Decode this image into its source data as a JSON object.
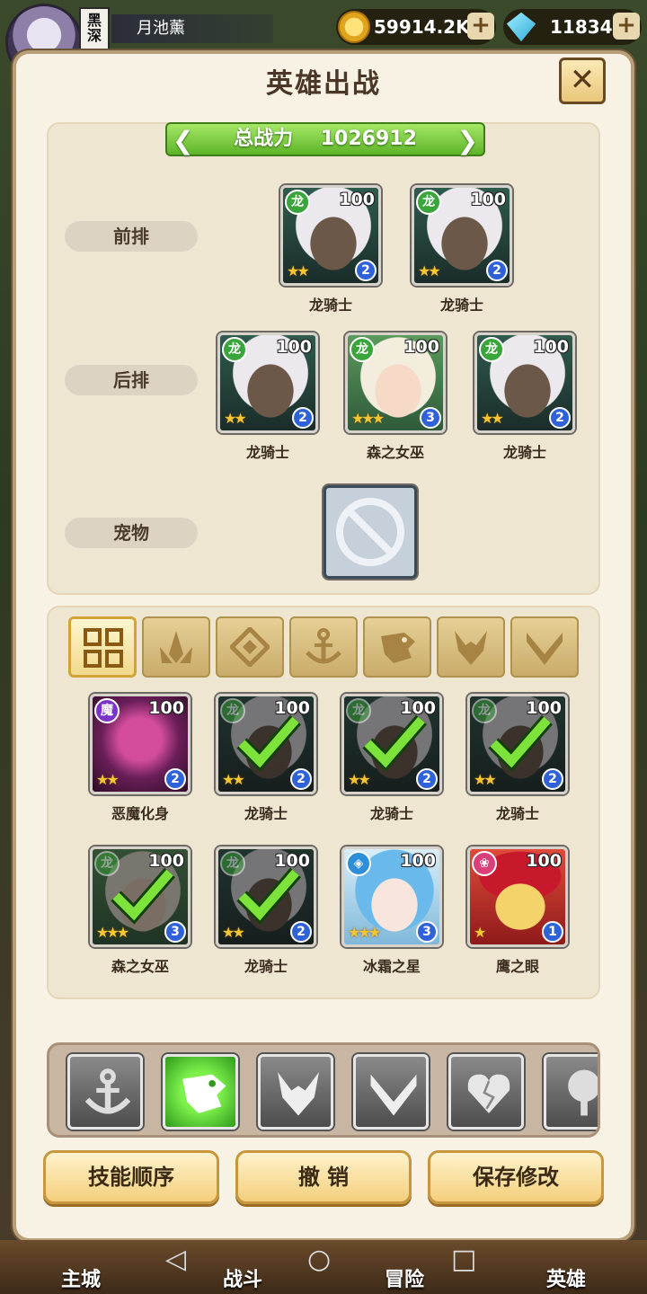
{
  "player": {
    "guild_tag": "黑\n深",
    "name": "月池薰"
  },
  "currency": {
    "gold": "59914.2K",
    "gems": "11834",
    "plus": "+"
  },
  "panel": {
    "title": "英雄出战",
    "close_icon": "close-icon"
  },
  "formation": {
    "power_label": "总战力",
    "power_value": "1026912",
    "rows": {
      "front": "前排",
      "back": "后排",
      "pet": "宠物"
    },
    "front": [
      {
        "name": "龙骑士",
        "level": "100",
        "rank": "2",
        "class": "dragon",
        "stars": "★★"
      },
      {
        "name": "龙骑士",
        "level": "100",
        "rank": "2",
        "class": "dragon",
        "stars": "★★"
      }
    ],
    "back": [
      {
        "name": "龙骑士",
        "level": "100",
        "rank": "2",
        "class": "dragon",
        "stars": "★★"
      },
      {
        "name": "森之女巫",
        "level": "100",
        "rank": "3",
        "class": "dragon",
        "stars": "★★★"
      },
      {
        "name": "龙骑士",
        "level": "100",
        "rank": "2",
        "class": "dragon",
        "stars": "★★"
      }
    ]
  },
  "roster": {
    "filters": [
      "all",
      "forest",
      "frost",
      "anchor",
      "dragon",
      "demon",
      "light"
    ],
    "heroes": [
      {
        "name": "恶魔化身",
        "level": "100",
        "rank": "2",
        "selected": false
      },
      {
        "name": "龙骑士",
        "level": "100",
        "rank": "2",
        "selected": true
      },
      {
        "name": "龙骑士",
        "level": "100",
        "rank": "2",
        "selected": true
      },
      {
        "name": "龙骑士",
        "level": "100",
        "rank": "2",
        "selected": true
      },
      {
        "name": "森之女巫",
        "level": "100",
        "rank": "3",
        "selected": true
      },
      {
        "name": "龙骑士",
        "level": "100",
        "rank": "2",
        "selected": true
      },
      {
        "name": "冰霜之星",
        "level": "100",
        "rank": "3",
        "selected": false
      },
      {
        "name": "鹰之眼",
        "level": "100",
        "rank": "1",
        "selected": false
      }
    ]
  },
  "buttons": {
    "skill_order": "技能顺序",
    "undo": "撤 销",
    "save": "保存修改"
  },
  "nav": {
    "city": "主城",
    "battle": "战斗",
    "adventure": "冒险",
    "hero": "英雄"
  },
  "colors": {
    "accent_green": "#5db428",
    "panel_bg": "#f8f2e4",
    "button_gold": "#f4cf7c"
  }
}
